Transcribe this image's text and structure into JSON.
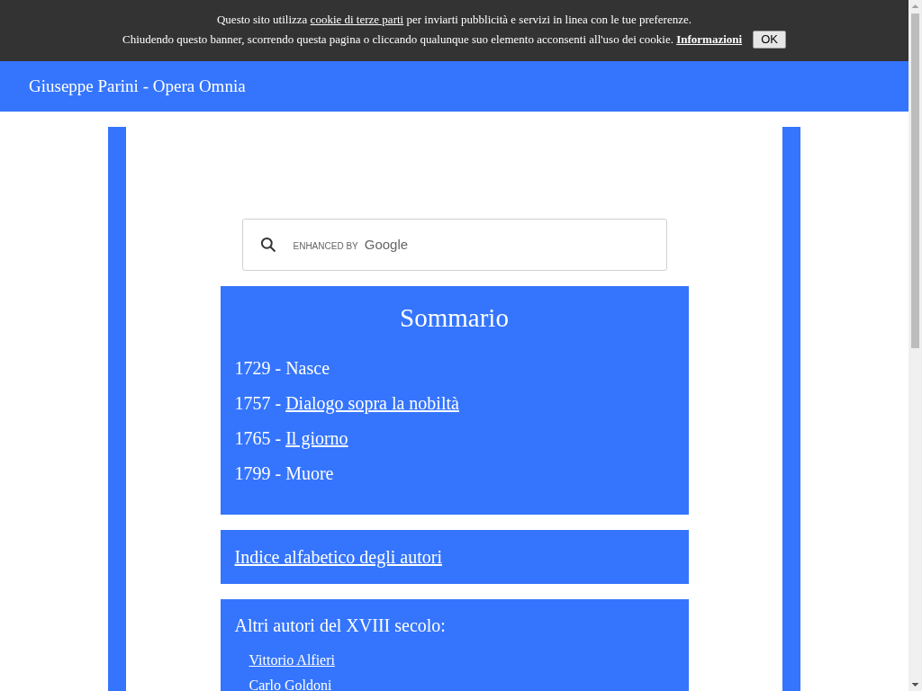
{
  "cookie_banner": {
    "line_1": {
      "before": "Questo sito utilizza ",
      "link": "cookie di terze parti",
      "after": " per inviarti pubblicità e servizi in linea con le tue preferenze."
    },
    "line_2": {
      "text": "Chiudendo questo banner, scorrendo questa pagina o cliccando qualunque suo elemento acconsenti all'uso dei cookie.",
      "link": "Informazioni"
    },
    "button": "OK"
  },
  "header": {
    "title": "Giuseppe Parini - Opera Omnia"
  },
  "search": {
    "placeholder_prefix": "ENHANCED BY",
    "placeholder_brand": "Google"
  },
  "summary": {
    "title": "Sommario",
    "items": [
      {
        "year": "1729",
        "separator": "-",
        "label": "Nasce",
        "linked": false
      },
      {
        "year": "1757",
        "separator": "-",
        "label": "Dialogo sopra la nobiltà",
        "linked": true
      },
      {
        "year": "1765",
        "separator": "-",
        "label": "Il giorno",
        "linked": true
      },
      {
        "year": "1799",
        "separator": "-",
        "label": "Muore",
        "linked": false
      }
    ]
  },
  "index_link": "Indice alfabetico degli autori",
  "other_authors": {
    "title": "Altri autori del XVIII secolo:",
    "authors": [
      "Vittorio Alfieri",
      "Carlo Goldoni"
    ]
  }
}
